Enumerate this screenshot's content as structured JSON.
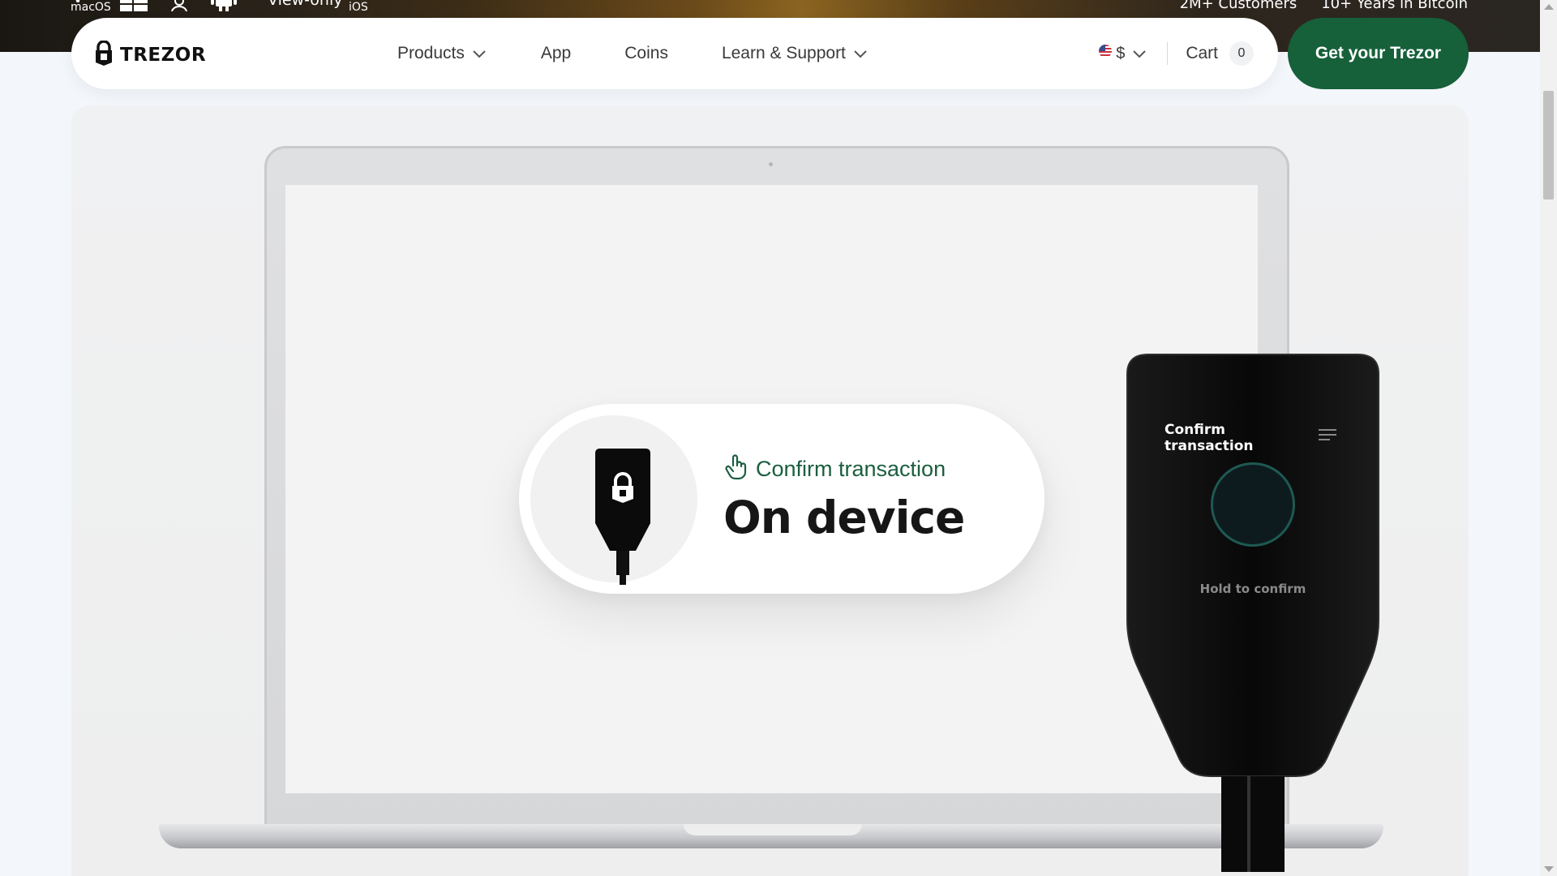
{
  "top_strip": {
    "platforms": [
      {
        "label": "macOS",
        "icon": "apple-icon"
      },
      {
        "label": "",
        "icon": "windows-icon"
      },
      {
        "label": "",
        "icon": "linux-icon"
      },
      {
        "label": "",
        "icon": "android-icon"
      }
    ],
    "view_only": "View-only",
    "ios_label": "iOS",
    "stats": [
      "2M+ Customers",
      "10+ Years in Bitcoin"
    ]
  },
  "nav": {
    "logo_text": "TREZOR",
    "links": [
      {
        "label": "Products",
        "dropdown": true
      },
      {
        "label": "App",
        "dropdown": false
      },
      {
        "label": "Coins",
        "dropdown": false
      },
      {
        "label": "Learn & Support",
        "dropdown": true
      }
    ],
    "currency": "$",
    "currency_flag": "us-flag-icon",
    "cart_label": "Cart",
    "cart_count": "0",
    "cta_label": "Get your Trezor",
    "cta_color": "#16603a"
  },
  "hero": {
    "confirm_label": "Confirm transaction",
    "headline": "On device",
    "device_title": "Confirm transaction",
    "device_hold_label": "Hold to confirm",
    "accent_color": "#1b5e40"
  }
}
